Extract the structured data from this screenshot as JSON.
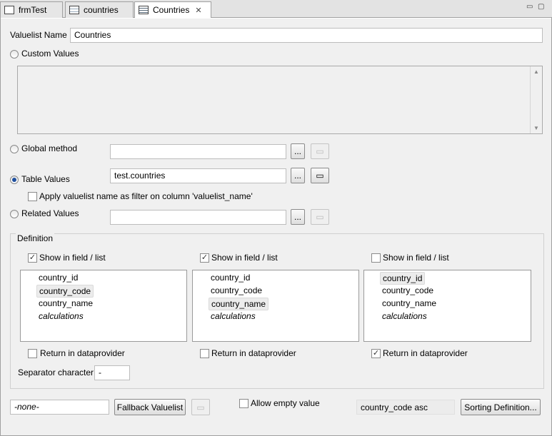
{
  "tabs": [
    {
      "label": "frmTest"
    },
    {
      "label": "countries"
    },
    {
      "label": "Countries",
      "close": "✕"
    }
  ],
  "window_controls": {
    "minimize": "▭",
    "maximize": "▢"
  },
  "form": {
    "name_label": "Valuelist Name",
    "name_value": "Countries",
    "custom_values_label": "Custom Values",
    "global_method_label": "Global method",
    "global_method_value": "",
    "table_values_label": "Table Values",
    "table_values_value": "test.countries",
    "apply_filter_label": "Apply valuelist name as filter on column 'valuelist_name'",
    "related_values_label": "Related Values",
    "related_values_value": "",
    "browse_label": "...",
    "selected_source": "Table Values"
  },
  "definition": {
    "legend": "Definition",
    "show_label": "Show in field / list",
    "return_label": "Return in dataprovider",
    "columns": [
      {
        "show": true,
        "return": false,
        "items": [
          "country_id",
          "country_code",
          "country_name",
          "calculations"
        ],
        "selected": "country_code"
      },
      {
        "show": true,
        "return": false,
        "items": [
          "country_id",
          "country_code",
          "country_name",
          "calculations"
        ],
        "selected": "country_name"
      },
      {
        "show": false,
        "return": true,
        "items": [
          "country_id",
          "country_code",
          "country_name",
          "calculations"
        ],
        "selected": "country_id"
      }
    ],
    "separator_label": "Separator character",
    "separator_value": "-"
  },
  "footer": {
    "fallback_value": "-none-",
    "fallback_button": "Fallback Valuelist",
    "allow_empty_label": "Allow empty value",
    "allow_empty": false,
    "sort_value": "country_code asc",
    "sort_button": "Sorting Definition..."
  }
}
